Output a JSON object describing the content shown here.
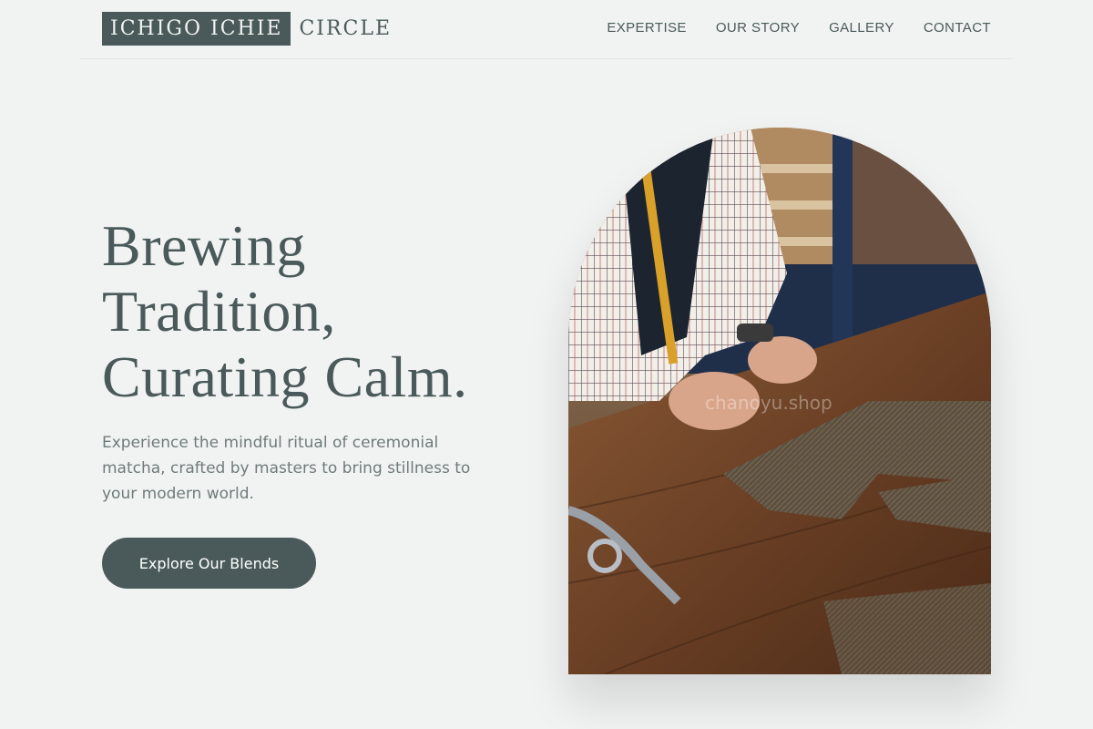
{
  "header": {
    "logo_box_text": "ICHIGO ICHIE",
    "logo_rest_text": "CIRCLE",
    "nav": [
      {
        "label": "EXPERTISE"
      },
      {
        "label": "OUR STORY"
      },
      {
        "label": "GALLERY"
      },
      {
        "label": "CONTACT"
      }
    ]
  },
  "hero": {
    "headline_line1": "Brewing",
    "headline_line2": "Tradition,",
    "headline_line3": "Curating Calm.",
    "subtext": "Experience the mindful ritual of ceremonial matcha, crafted by masters to bring stillness to your modern world.",
    "cta_label": "Explore Our Blends",
    "image_watermark": "chanoyu.shop"
  },
  "colors": {
    "background": "#f1f3f2",
    "primary": "#4a5a5a",
    "text_muted": "#6e7b7b"
  }
}
